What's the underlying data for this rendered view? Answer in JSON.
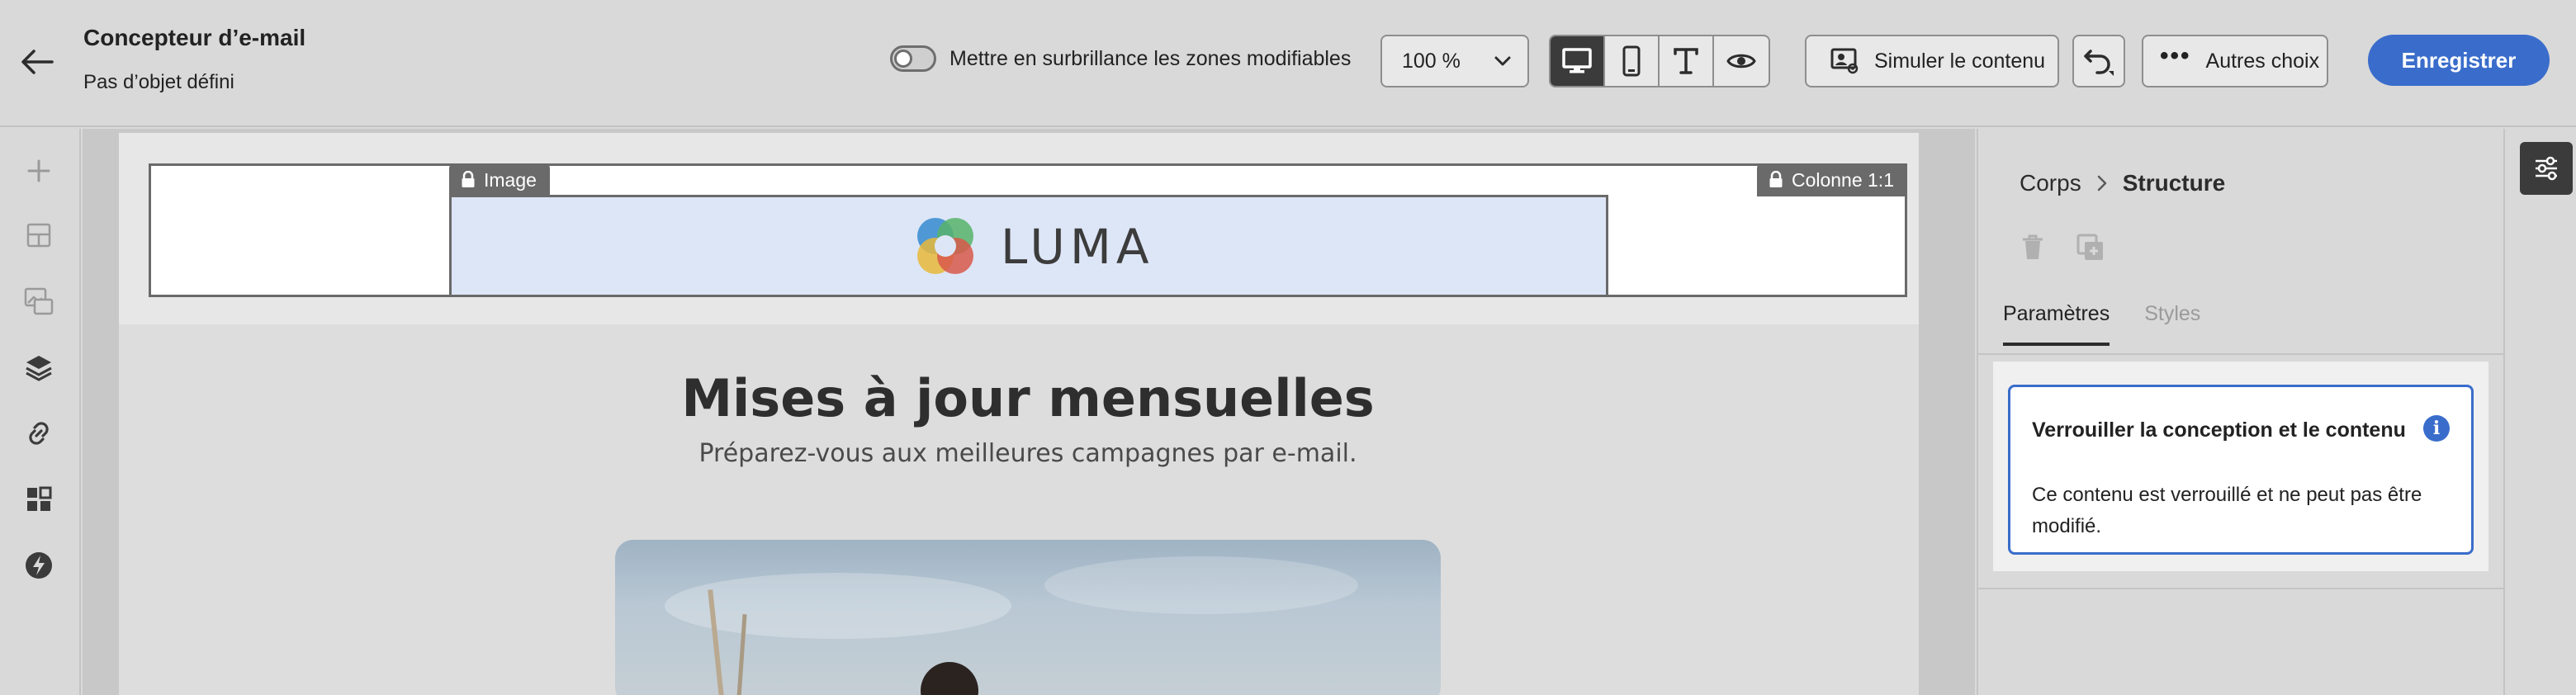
{
  "header": {
    "title": "Concepteur d’e-mail",
    "subtitle": "Pas d’objet défini",
    "highlight_toggle_label": "Mettre en surbrillance les zones modifiables",
    "highlight_toggle_on": false,
    "zoom_value": "100 %",
    "view_modes": [
      "desktop",
      "mobile",
      "text",
      "preview"
    ],
    "active_view": "desktop",
    "simulate_label": "Simuler le contenu",
    "more_label": "Autres choix",
    "save_label": "Enregistrer"
  },
  "left_rail": {
    "icons": [
      "plus-icon",
      "structure-icon",
      "image-gallery-icon",
      "layers-icon",
      "link-icon",
      "fragments-icon",
      "lightning-icon"
    ]
  },
  "canvas": {
    "tag_image": "Image",
    "tag_column": "Colonne 1:1",
    "logo_text": "LUMA",
    "headline": "Mises à jour mensuelles",
    "subline": "Préparez-vous aux meilleures campagnes par e-mail."
  },
  "right_panel": {
    "breadcrumb": {
      "parent": "Corps",
      "current": "Structure"
    },
    "tabs": [
      {
        "label": "Paramètres",
        "active": true
      },
      {
        "label": "Styles",
        "active": false
      }
    ],
    "lock_card": {
      "title": "Verrouiller la conception et le contenu",
      "body": "Ce contenu est verrouillé et ne peut pas être modifié."
    }
  },
  "colors": {
    "accent": "#3a6dcb",
    "dark_button": "#3b3b3b",
    "image_selection": "#dde6f7"
  }
}
